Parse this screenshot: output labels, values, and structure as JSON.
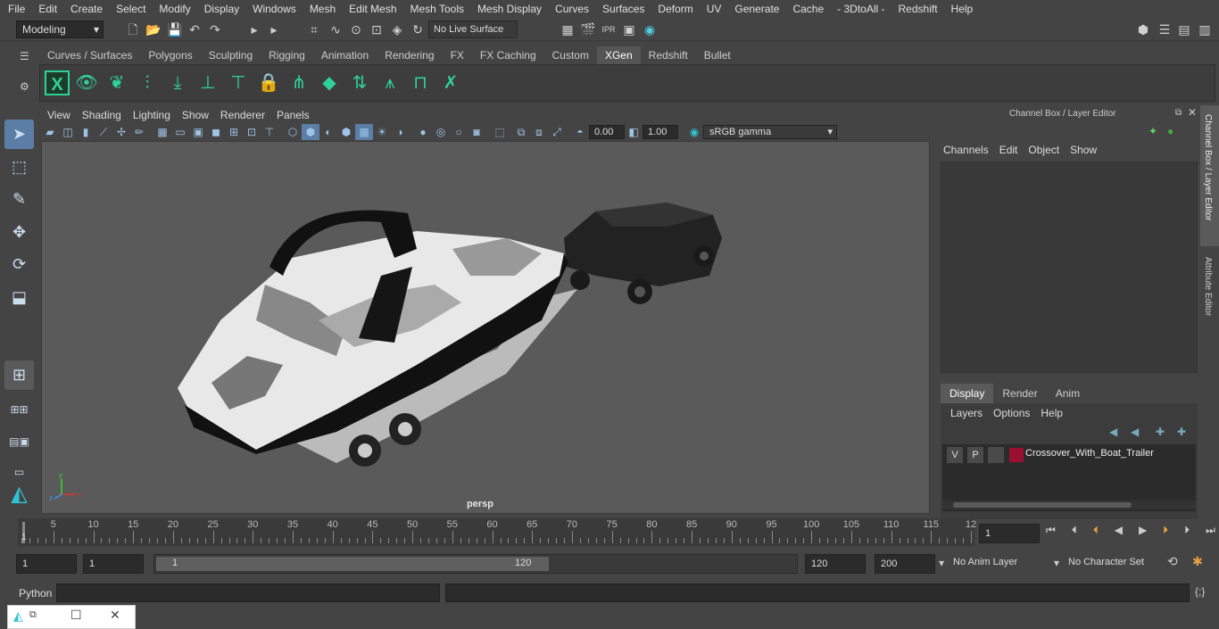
{
  "menubar": [
    "File",
    "Edit",
    "Create",
    "Select",
    "Modify",
    "Display",
    "Windows",
    "Mesh",
    "Edit Mesh",
    "Mesh Tools",
    "Mesh Display",
    "Curves",
    "Surfaces",
    "Deform",
    "UV",
    "Generate",
    "Cache",
    "- 3DtoAll -",
    "Redshift",
    "Help"
  ],
  "status": {
    "mode": "Modeling",
    "live_surface": "No Live Surface"
  },
  "shelf_tabs": [
    "Curves / Surfaces",
    "Polygons",
    "Sculpting",
    "Rigging",
    "Animation",
    "Rendering",
    "FX",
    "FX Caching",
    "Custom",
    "XGen",
    "Redshift",
    "Bullet"
  ],
  "active_shelf_tab": "XGen",
  "viewport": {
    "menu": [
      "View",
      "Shading",
      "Lighting",
      "Show",
      "Renderer",
      "Panels"
    ],
    "exposure": "0.00",
    "gamma": "1.00",
    "color_space": "sRGB gamma",
    "camera": "persp"
  },
  "channel_box": {
    "title": "Channel Box / Layer Editor",
    "menu": [
      "Channels",
      "Edit",
      "Object",
      "Show"
    ],
    "layer_tabs": [
      "Display",
      "Render",
      "Anim"
    ],
    "active_layer_tab": "Display",
    "layer_menu": [
      "Layers",
      "Options",
      "Help"
    ],
    "layer": {
      "v": "V",
      "p": "P",
      "name": "Crossover_With_Boat_Trailer",
      "color": "#9b1030"
    }
  },
  "side_tabs": [
    "Channel Box / Layer Editor",
    "Attribute Editor"
  ],
  "timeline": {
    "ticks": [
      "5",
      "10",
      "15",
      "20",
      "25",
      "30",
      "35",
      "40",
      "45",
      "50",
      "55",
      "60",
      "65",
      "70",
      "75",
      "80",
      "85",
      "90",
      "95",
      "100",
      "105",
      "110",
      "115",
      "12"
    ],
    "start_marker": "1",
    "current_frame": "1"
  },
  "range": {
    "start": "1",
    "playback_start": "1",
    "slider_start": "1",
    "slider_end": "120",
    "end": "120",
    "anim_end": "200",
    "anim_layer": "No Anim Layer",
    "char_set": "No Character Set"
  },
  "python": {
    "label": "Python"
  }
}
